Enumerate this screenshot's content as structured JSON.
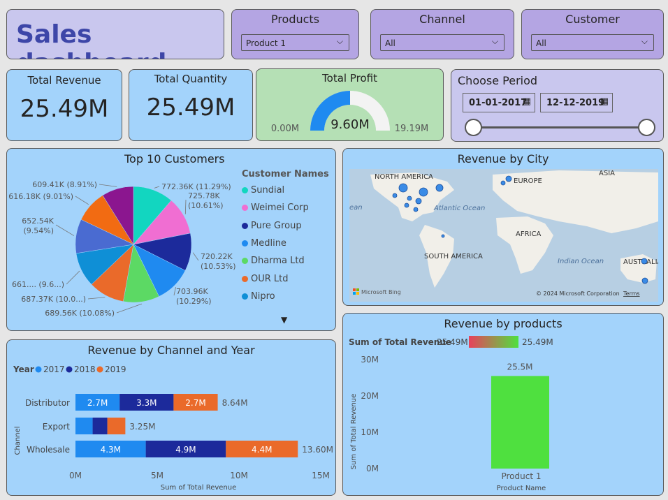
{
  "header": {
    "title": "Sales dashboard"
  },
  "slicers": {
    "products": {
      "label": "Products",
      "value": "Product 1"
    },
    "channel": {
      "label": "Channel",
      "value": "All"
    },
    "customer": {
      "label": "Customer",
      "value": "All"
    }
  },
  "kpis": {
    "revenue": {
      "label": "Total Revenue",
      "value": "25.49M"
    },
    "quantity": {
      "label": "Total Quantity",
      "value": "25.49M"
    },
    "profit": {
      "label": "Total Profit",
      "value": "9.60M",
      "min": "0.00M",
      "max": "19.19M",
      "fraction": 0.5
    }
  },
  "period": {
    "label": "Choose Period",
    "start": "01-01-2017",
    "end": "12-12-2019"
  },
  "customers": {
    "title": "Top 10 Customers",
    "legend_title": "Customer Names",
    "legend": [
      {
        "name": "Sundial",
        "color": "#12d6c0"
      },
      {
        "name": "Weimei Corp",
        "color": "#f06ed2"
      },
      {
        "name": "Pure Group",
        "color": "#1c2a9b"
      },
      {
        "name": "Medline",
        "color": "#1f8af0"
      },
      {
        "name": "Dharma Ltd",
        "color": "#5cd964"
      },
      {
        "name": "OUR Ltd",
        "color": "#ea6a2a"
      },
      {
        "name": "Nipro",
        "color": "#0f8fd6"
      }
    ]
  },
  "city": {
    "title": "Revenue by City",
    "labels": [
      "NORTH AMERICA",
      "EUROPE",
      "ASIA",
      "Atlantic Ocean",
      "AFRICA",
      "SOUTH AMERICA",
      "Indian Ocean",
      "AUSTRALIA",
      "ean"
    ],
    "bing": "Microsoft Bing",
    "copyright": "© 2024 Microsoft Corporation",
    "terms": "Terms"
  },
  "channel_chart": {
    "title": "Revenue by Channel and Year",
    "legend_title": "Year",
    "ylabel": "Channel",
    "xlabel": "Sum of Total Revenue",
    "ticks": [
      "0M",
      "5M",
      "10M",
      "15M"
    ]
  },
  "products_chart": {
    "title": "Revenue by products",
    "legend_label": "Sum of Total Revenue",
    "legend_min": "25.49M",
    "legend_max": "25.49M",
    "ylabel": "Sum of Total Revenue",
    "xlabel": "Product Name",
    "ticks": [
      "0M",
      "10M",
      "20M",
      "30M"
    ]
  },
  "chart_data": [
    {
      "type": "pie",
      "title": "Top 10 Customers",
      "slices": [
        {
          "label": "772.36K (11.29%)",
          "value": 772.36,
          "color": "#12d6c0"
        },
        {
          "label": "725.78K (10.61%)",
          "value": 725.78,
          "color": "#f06ed2"
        },
        {
          "label": "720.22K (10.53%)",
          "value": 720.22,
          "color": "#1c2a9b"
        },
        {
          "label": "703.96K (10.29%)",
          "value": 703.96,
          "color": "#1f8af0"
        },
        {
          "label": "689.56K (10.08%)",
          "value": 689.56,
          "color": "#5cd964"
        },
        {
          "label": "687.37K (10.0...)",
          "value": 687.37,
          "color": "#ea6a2a"
        },
        {
          "label": "661.... (9.6...)",
          "value": 661.0,
          "color": "#0f8fd6"
        },
        {
          "label": "652.54K (9.54%)",
          "value": 652.54,
          "color": "#4a6bd1"
        },
        {
          "label": "616.18K (9.01%)",
          "value": 616.18,
          "color": "#f26b12"
        },
        {
          "label": "609.41K (8.91%)",
          "value": 609.41,
          "color": "#8b168f"
        }
      ]
    },
    {
      "type": "bar",
      "title": "Revenue by Channel and Year",
      "categories": [
        "Distributor",
        "Export",
        "Wholesale"
      ],
      "series": [
        {
          "name": "2017",
          "color": "#1f8af0",
          "values": [
            2.7,
            1.05
          ],
          "labels": [
            "2.7M",
            ""
          ]
        },
        {
          "name": "2018",
          "color": "#1c2a9b",
          "values": [
            3.3,
            0.9
          ],
          "labels": [
            "3.3M",
            ""
          ]
        },
        {
          "name": "2019",
          "color": "#ea6a2a",
          "values": [
            2.7,
            1.1
          ],
          "labels": [
            "2.7M",
            ""
          ]
        }
      ],
      "wholesale": [
        4.3,
        4.9,
        4.4
      ],
      "wholesale_labels": [
        "4.3M",
        "4.9M",
        "4.4M"
      ],
      "totals": [
        "8.64M",
        "3.25M",
        "13.60M"
      ],
      "xlim": [
        0,
        15
      ]
    },
    {
      "type": "bar",
      "title": "Revenue by products",
      "categories": [
        "Product 1"
      ],
      "values": [
        25.5
      ],
      "value_label": "25.5M",
      "ylim": [
        0,
        30
      ]
    }
  ]
}
